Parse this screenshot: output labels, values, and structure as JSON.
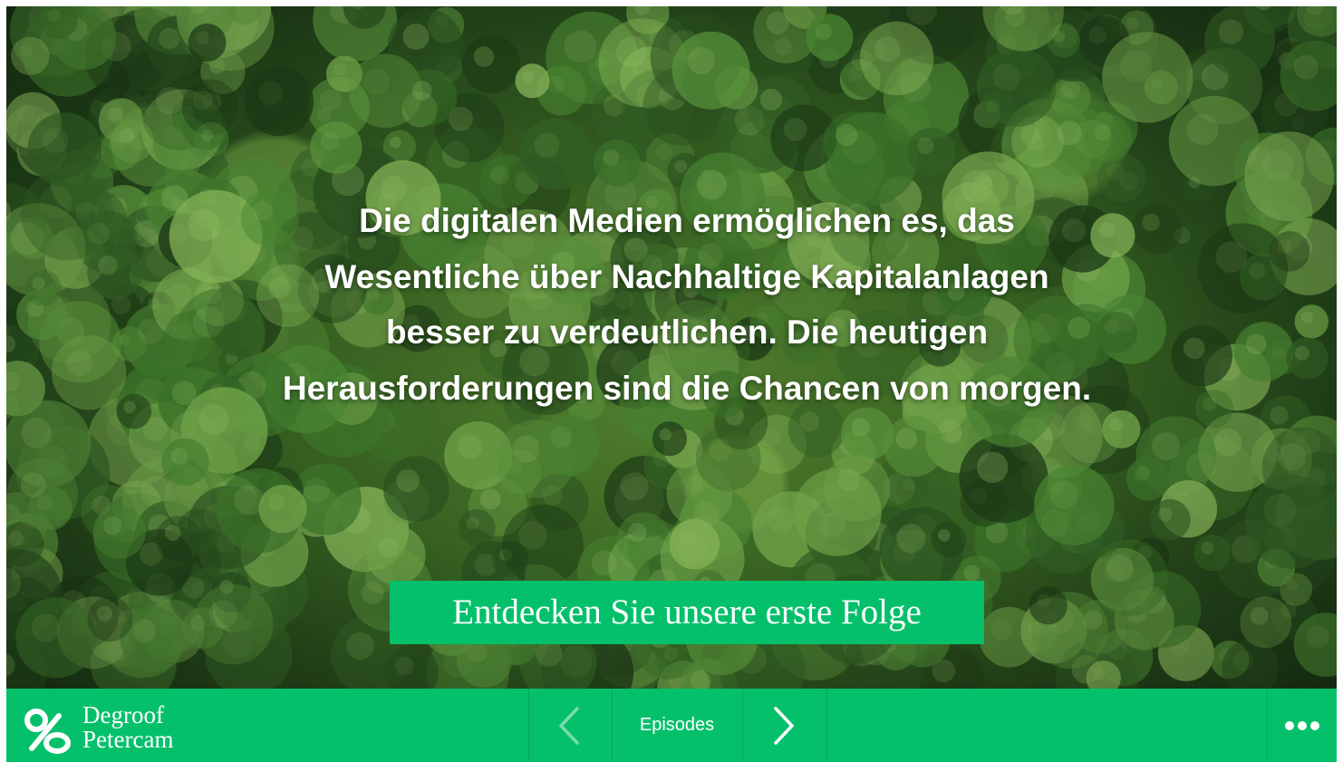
{
  "hero": {
    "headline": "Die digitalen Medien ermöglichen es, das Wesentliche über Nachhaltige Kapitalanlagen besser zu verdeutlichen. Die heutigen Herausforderungen sind die Chancen von morgen.",
    "cta_label": "Entdecken Sie unsere erste Folge",
    "background_image": "aerial-forest"
  },
  "bottom_bar": {
    "logo_line1": "Degroof",
    "logo_line2": "Petercam",
    "episodes_label": "Episodes",
    "prev_icon": "chevron-left-icon",
    "next_icon": "chevron-right-icon",
    "more_icon": "more-dots-icon"
  },
  "colors": {
    "brand_green": "#05c06b",
    "text": "#ffffff"
  }
}
